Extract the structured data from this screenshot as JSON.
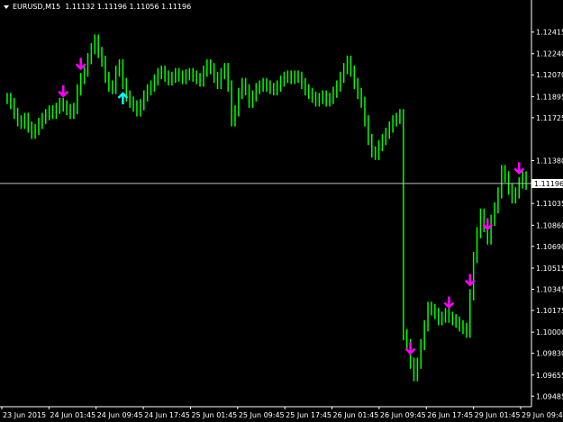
{
  "header": {
    "symbol": "EURUSD,M15",
    "ohlc": "1.11132 1.11196 1.11056 1.11196"
  },
  "colors": {
    "background": "#000000",
    "bars": "#00ff00",
    "axis": "#ffffff",
    "sell_arrow": "#ff00ff",
    "buy_arrow": "#00ffff",
    "price_line": "#c0c0c0"
  },
  "chart_data": {
    "type": "line",
    "ylim": [
      1.094,
      1.126
    ],
    "price_line": 1.11196,
    "price_label": "1.11196",
    "y_ticks": [
      "1.12415",
      "1.12240",
      "1.12070",
      "1.11895",
      "1.11725",
      "1.11380",
      "1.11205",
      "1.11035",
      "1.10860",
      "1.10690",
      "1.10515",
      "1.10345",
      "1.10175",
      "1.10000",
      "1.09830",
      "1.09655",
      "1.09485"
    ],
    "x_ticks": [
      "23 Jun 2015",
      "24 Jun 01:45",
      "24 Jun 09:45",
      "24 Jun 17:45",
      "25 Jun 01:45",
      "25 Jun 09:45",
      "25 Jun 17:45",
      "26 Jun 01:45",
      "26 Jun 09:45",
      "26 Jun 17:45",
      "29 Jun 01:45",
      "29 Jun 09:45"
    ],
    "series": [
      {
        "values": [
          1.1188,
          1.1184,
          1.1176,
          1.117,
          1.1168,
          1.1172,
          1.1165,
          1.116,
          1.1163,
          1.1168,
          1.1172,
          1.1175,
          1.1178,
          1.1176,
          1.118,
          1.1184,
          1.1182,
          1.1179,
          1.1176,
          1.118,
          1.1195,
          1.1204,
          1.121,
          1.122,
          1.1228,
          1.1235,
          1.1225,
          1.1218,
          1.1205,
          1.1198,
          1.1196,
          1.121,
          1.1215,
          1.12,
          1.119,
          1.1185,
          1.1182,
          1.1178,
          1.1183,
          1.119,
          1.1195,
          1.1198,
          1.1203,
          1.1208,
          1.121,
          1.1206,
          1.1203,
          1.1205,
          1.1208,
          1.1206,
          1.1204,
          1.1207,
          1.1208,
          1.1206,
          1.1204,
          1.1202,
          1.121,
          1.1215,
          1.1212,
          1.1205,
          1.12,
          1.1208,
          1.1212,
          1.1198,
          1.117,
          1.1178,
          1.1192,
          1.12,
          1.1195,
          1.1185,
          1.119,
          1.1196,
          1.1198,
          1.12,
          1.1198,
          1.1196,
          1.1195,
          1.1198,
          1.1202,
          1.1205,
          1.1206,
          1.1204,
          1.1206,
          1.1205,
          1.12,
          1.1195,
          1.1192,
          1.1189,
          1.1186,
          1.1188,
          1.119,
          1.1186,
          1.1188,
          1.1193,
          1.1198,
          1.1205,
          1.1212,
          1.1218,
          1.121,
          1.12,
          1.1192,
          1.1185,
          1.117,
          1.1155,
          1.1145,
          1.1143,
          1.115,
          1.1155,
          1.116,
          1.1165,
          1.117,
          1.1172,
          1.1175,
          1.0998,
          1.099,
          1.0975,
          1.0965,
          1.0975,
          1.099,
          1.1005,
          1.102,
          1.1018,
          1.1015,
          1.101,
          1.1012,
          1.1015,
          1.1012,
          1.101,
          1.1008,
          1.1005,
          1.1003,
          1.1,
          1.103,
          1.106,
          1.108,
          1.1095,
          1.1085,
          1.1075,
          1.109,
          1.11,
          1.1112,
          1.113,
          1.1125,
          1.1115,
          1.1108,
          1.1112,
          1.112,
          1.1125,
          1.1119
        ]
      }
    ]
  },
  "signals": [
    {
      "type": "sell",
      "index": 16
    },
    {
      "type": "sell",
      "index": 21
    },
    {
      "type": "buy",
      "index": 33
    },
    {
      "type": "sell",
      "index": 115
    },
    {
      "type": "sell",
      "index": 126
    },
    {
      "type": "sell",
      "index": 132
    },
    {
      "type": "sell",
      "index": 137
    },
    {
      "type": "sell",
      "index": 146
    }
  ]
}
